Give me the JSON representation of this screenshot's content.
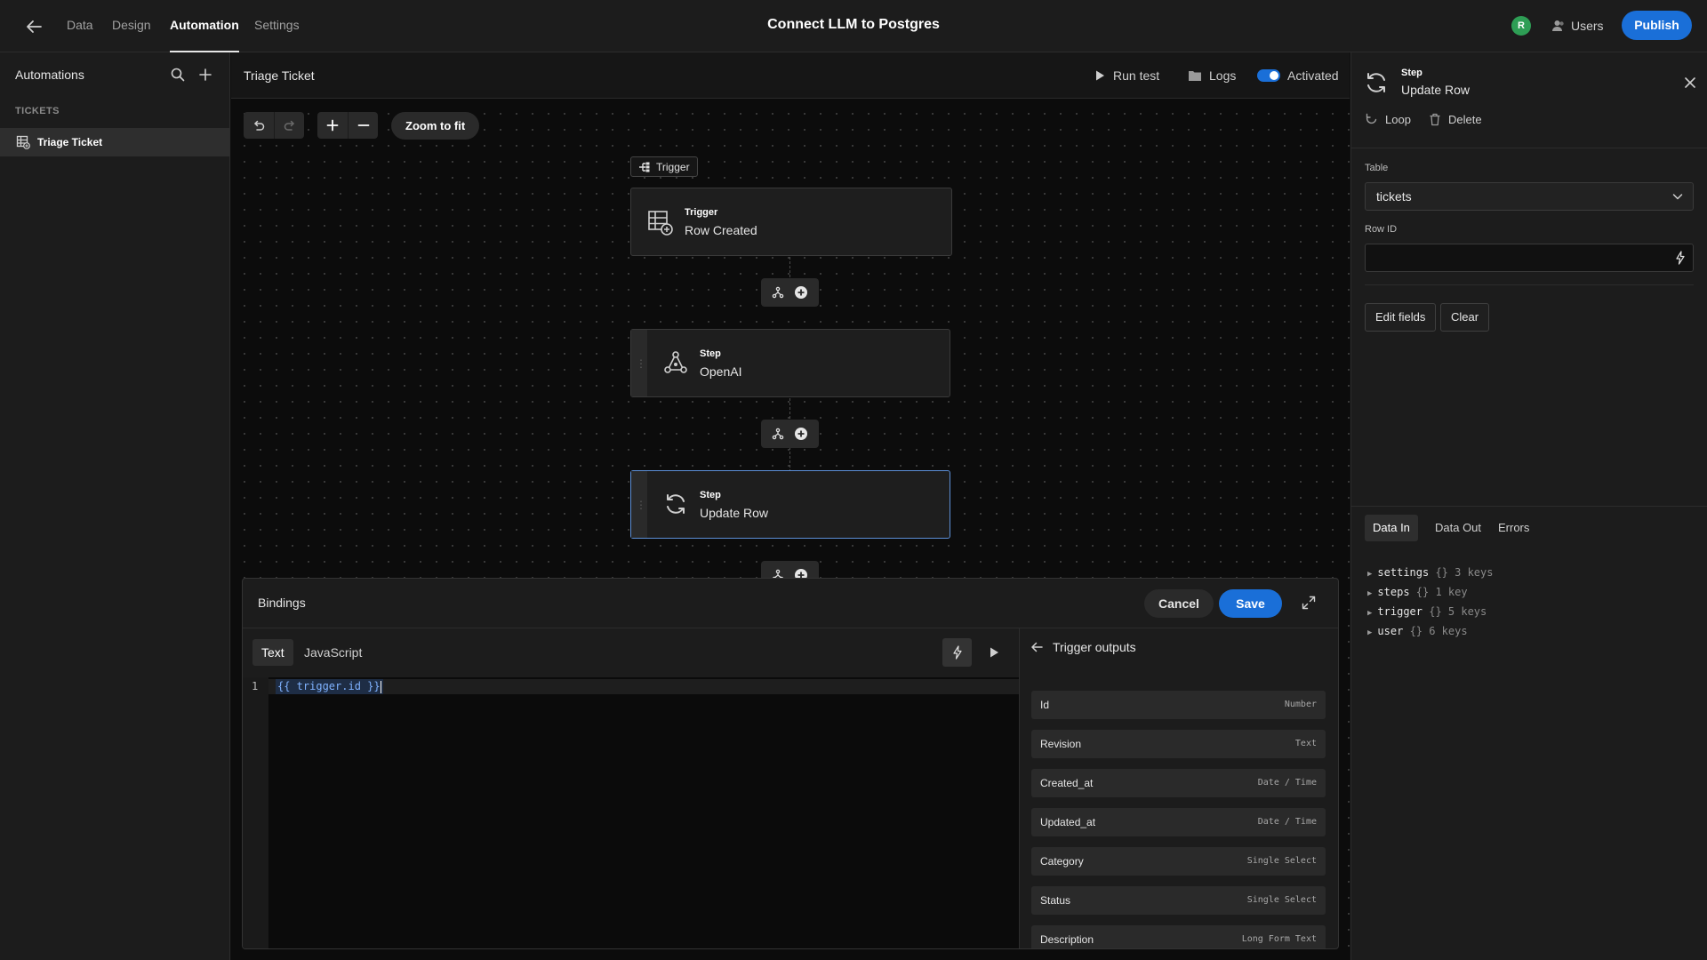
{
  "topbar": {
    "nav": [
      "Data",
      "Design",
      "Automation",
      "Settings"
    ],
    "active_nav": "Automation",
    "app_title": "Connect LLM to Postgres",
    "avatar_initial": "R",
    "users_label": "Users",
    "publish_label": "Publish"
  },
  "sidebar": {
    "title": "Automations",
    "section": "TICKETS",
    "items": [
      {
        "label": "Triage Ticket"
      }
    ]
  },
  "canvas": {
    "title": "Triage Ticket",
    "run_test_label": "Run test",
    "logs_label": "Logs",
    "activated_label": "Activated",
    "activated": true,
    "zoom_to_fit_label": "Zoom to fit",
    "trigger_chip_label": "Trigger",
    "nodes": [
      {
        "kind": "Trigger",
        "name": "Row Created"
      },
      {
        "kind": "Step",
        "name": "OpenAI"
      },
      {
        "kind": "Step",
        "name": "Update Row"
      }
    ]
  },
  "bindings": {
    "title": "Bindings",
    "cancel_label": "Cancel",
    "save_label": "Save",
    "modes": [
      "Text",
      "JavaScript"
    ],
    "active_mode": "Text",
    "line_number": "1",
    "code": "{{ trigger.id }}",
    "outputs_title": "Trigger outputs",
    "outputs": [
      {
        "name": "Id",
        "type": "Number"
      },
      {
        "name": "Revision",
        "type": "Text"
      },
      {
        "name": "Created_at",
        "type": "Date / Time"
      },
      {
        "name": "Updated_at",
        "type": "Date / Time"
      },
      {
        "name": "Category",
        "type": "Single Select"
      },
      {
        "name": "Status",
        "type": "Single Select"
      },
      {
        "name": "Description",
        "type": "Long Form Text"
      }
    ]
  },
  "rightpanel": {
    "kind": "Step",
    "name": "Update Row",
    "loop_label": "Loop",
    "delete_label": "Delete",
    "table_label": "Table",
    "table_value": "tickets",
    "rowid_label": "Row ID",
    "rowid_value": "",
    "edit_fields_label": "Edit fields",
    "clear_label": "Clear",
    "data_tabs": [
      "Data In",
      "Data Out",
      "Errors"
    ],
    "active_data_tab": "Data In",
    "tree": [
      {
        "key": "settings",
        "meta": "{} 3 keys"
      },
      {
        "key": "steps",
        "meta": "{} 1 key"
      },
      {
        "key": "trigger",
        "meta": "{} 5 keys"
      },
      {
        "key": "user",
        "meta": "{} 6 keys"
      }
    ]
  },
  "colors": {
    "accent": "#1a6fd8",
    "avatar": "#2e9e55",
    "selected_border": "#5c8fd6"
  }
}
